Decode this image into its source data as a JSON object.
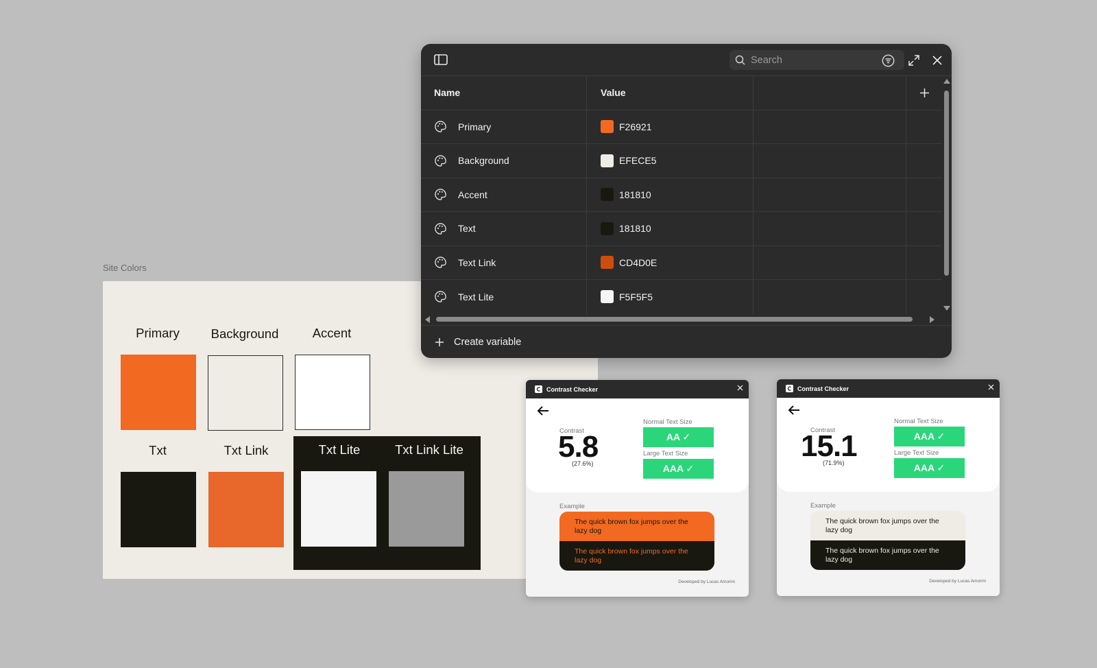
{
  "board": {
    "title": "Site Colors",
    "swatches": [
      {
        "label": "Primary",
        "color": "#f26921"
      },
      {
        "label": "Background",
        "color": "#efece5"
      },
      {
        "label": "Accent",
        "color": "#ffffff"
      },
      {
        "label": "Txt",
        "color": "#181810"
      },
      {
        "label": "Txt Link",
        "color": "#e8672a"
      },
      {
        "label": "Txt Lite",
        "color": "#f5f5f5"
      },
      {
        "label": "Txt Link Lite",
        "color": "#9a9a9a"
      }
    ]
  },
  "variables": {
    "search_placeholder": "Search",
    "columns": {
      "name": "Name",
      "value": "Value"
    },
    "rows": [
      {
        "name": "Primary",
        "value": "F26921",
        "color": "#f26921"
      },
      {
        "name": "Background",
        "value": "EFECE5",
        "color": "#efece5"
      },
      {
        "name": "Accent",
        "value": "181810",
        "color": "#181810"
      },
      {
        "name": "Text",
        "value": "181810",
        "color": "#181810"
      },
      {
        "name": "Text Link",
        "value": "CD4D0E",
        "color": "#cd4d0e"
      },
      {
        "name": "Text Lite",
        "value": "F5F5F5",
        "color": "#f5f5f5"
      }
    ],
    "create_label": "Create variable",
    "icons": [
      "sidebar-toggle-icon",
      "search-icon",
      "filter-icon",
      "expand-icon",
      "close-icon",
      "palette-icon",
      "plus-icon"
    ]
  },
  "checkers": [
    {
      "title": "Contrast Checker",
      "contrast_label": "Contrast",
      "ratio": "5.8",
      "percent": "(27.6%)",
      "normal_label": "Normal Text Size",
      "normal_badge": "AA ✓",
      "large_label": "Large Text Size",
      "large_badge": "AAA ✓",
      "example_label": "Example",
      "sample1": "The quick brown fox jumps over the lazy dog",
      "sample2": "The quick brown fox jumps over the lazy dog",
      "developer": "Developed by Lucas Amorim",
      "colors": {
        "s1_bg": "#f26921",
        "s1_fg": "#181810",
        "s2_bg": "#181810",
        "s2_fg": "#f26921"
      }
    },
    {
      "title": "Contrast Checker",
      "contrast_label": "Contrast",
      "ratio": "15.1",
      "percent": "(71.9%)",
      "normal_label": "Normal Text Size",
      "normal_badge": "AAA ✓",
      "large_label": "Large Text Size",
      "large_badge": "AAA ✓",
      "example_label": "Example",
      "sample1": "The quick brown fox jumps over the lazy dog",
      "sample2": "The quick brown fox jumps over the lazy dog",
      "developer": "Developed by Lucas Amorim",
      "colors": {
        "s1_bg": "#efece5",
        "s1_fg": "#181810",
        "s2_bg": "#181810",
        "s2_fg": "#efece5"
      }
    }
  ],
  "badge_color": "#2bd67b"
}
